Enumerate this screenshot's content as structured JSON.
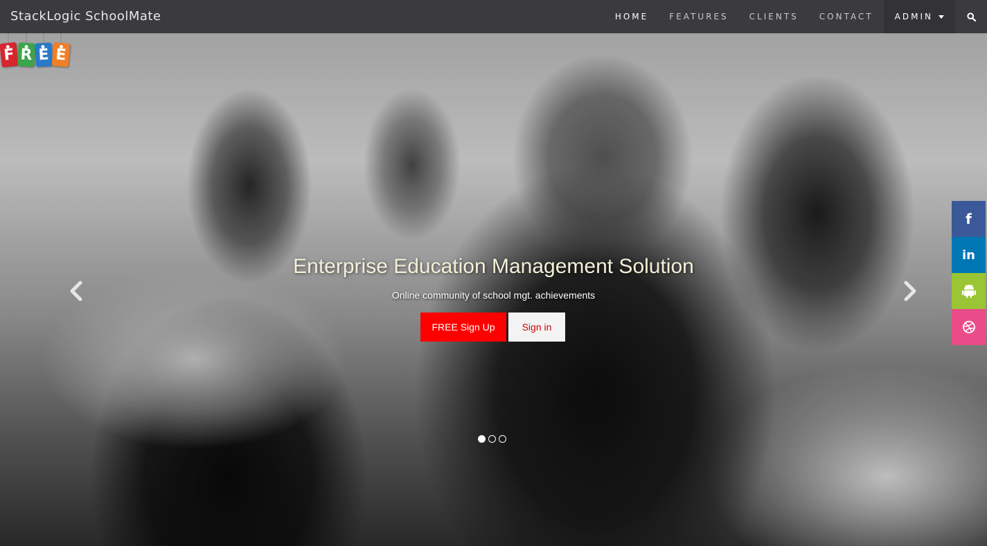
{
  "navbar": {
    "brand": "StackLogic SchoolMate",
    "items": [
      {
        "label": "HOME"
      },
      {
        "label": "FEATURES"
      },
      {
        "label": "CLIENTS"
      },
      {
        "label": "CONTACT"
      },
      {
        "label": "ADMIN"
      }
    ],
    "search_icon": "search-icon"
  },
  "badge": {
    "letters": [
      "F",
      "R",
      "E",
      "E"
    ],
    "colors": [
      "#d7262e",
      "#3aa649",
      "#2a79c8",
      "#f07f28"
    ]
  },
  "hero": {
    "title": "Enterprise Education Management Solution",
    "subtitle": "Online community of school mgt. achievements",
    "signup_label": "FREE Sign Up",
    "signin_label": "Sign in",
    "slide_count": 3,
    "active_slide": 1
  },
  "social": [
    {
      "name": "facebook",
      "icon": "facebook-icon",
      "color": "#3b5998"
    },
    {
      "name": "linkedin",
      "icon": "linkedin-icon",
      "color": "#0077b5"
    },
    {
      "name": "android",
      "icon": "android-icon",
      "color": "#9ac534"
    },
    {
      "name": "dribbble",
      "icon": "dribbble-icon",
      "color": "#ea4c89"
    }
  ],
  "colors": {
    "navbar_bg": "#3b3a3f",
    "signup_bg": "#ff0000",
    "signin_text": "#d00000"
  }
}
